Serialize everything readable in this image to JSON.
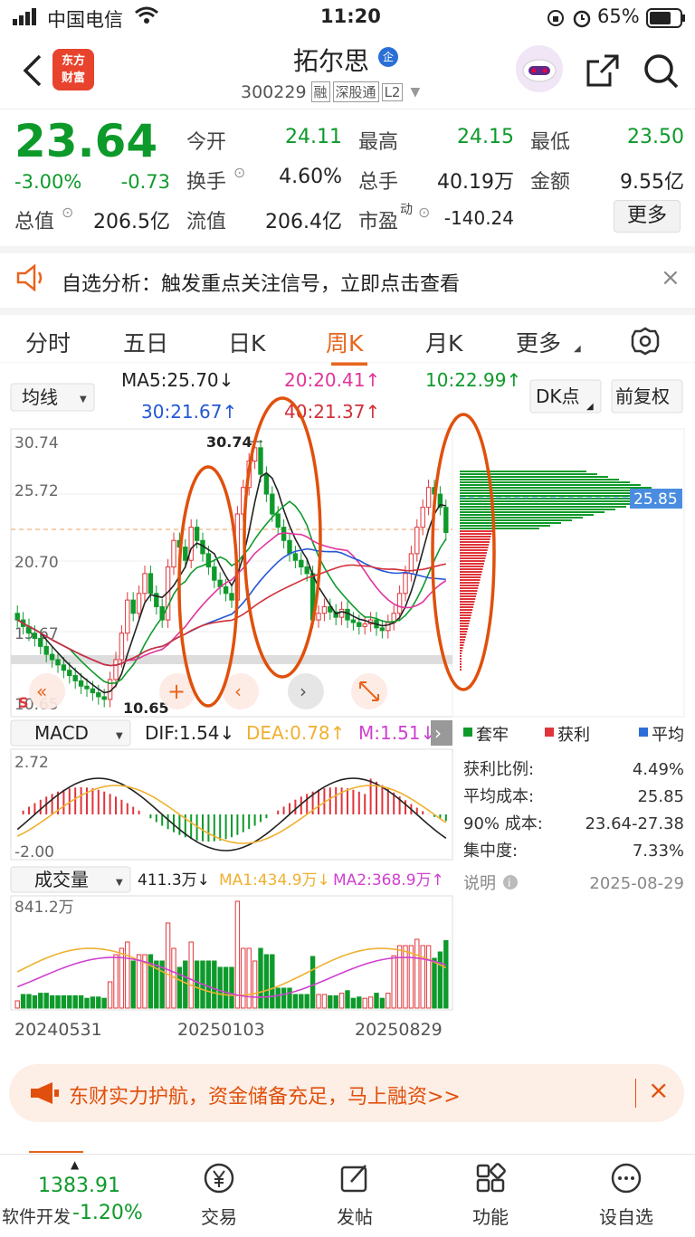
{
  "status_bar": {
    "carrier": "中国电信",
    "time": "11:20",
    "battery": "65%"
  },
  "header": {
    "logo_line1": "东方",
    "logo_line2": "财富",
    "stock_name": "拓尔思",
    "code": "300229",
    "badge_rong": "融",
    "badge_sgt": "深股通",
    "badge_l2": "L2"
  },
  "quote": {
    "price": "23.64",
    "change_pct": "-3.00%",
    "change": "-0.73",
    "open_label": "今开",
    "open": "24.11",
    "high_label": "最高",
    "high": "24.15",
    "low_label": "最低",
    "low": "23.50",
    "turnover_label": "换手",
    "turnover": "4.60%",
    "volume_label": "总手",
    "volume": "40.19万",
    "amount_label": "金额",
    "amount": "9.55亿",
    "mktcap_label": "总值",
    "mktcap": "206.5亿",
    "float_label": "流值",
    "float": "206.4亿",
    "pe_label": "市盈",
    "pe_sup": "动",
    "pe": "-140.24",
    "more_label": "更多"
  },
  "notice": {
    "text": "自选分析：触发重点关注信号，立即点击查看"
  },
  "tabs": [
    "分时",
    "五日",
    "日K",
    "周K",
    "月K",
    "更多"
  ],
  "active_tab": "周K",
  "chart": {
    "ma_select": "均线",
    "ma5": "MA5:25.70↓",
    "ma20": "20:20.41↑",
    "ma10": "10:22.99↑",
    "ma30": "30:21.67↑",
    "ma40": "40:21.37↑",
    "dk_label": "DK点",
    "adjust_label": "前复权",
    "y_labels": [
      "30.74",
      "25.72",
      "20.70",
      "15.67",
      "10.65"
    ],
    "high_mark": "30.74",
    "low_mark": "10.65",
    "chip_price": "25.85",
    "macd_select": "MACD",
    "dif": "DIF:1.54↓",
    "dea": "DEA:0.78↑",
    "m": "M:1.51↓",
    "macd_top": "2.72",
    "macd_bottom": "-2.00",
    "vol_select": "成交量",
    "vol_val": "411.3万↓",
    "vol_ma1": "MA1:434.9万↓",
    "vol_ma2": "MA2:368.9万↑",
    "vol_top": "841.2万",
    "x_labels": [
      "20240531",
      "20250103",
      "20250829"
    ]
  },
  "chips": {
    "legend": [
      "套牢",
      "获利",
      "平均"
    ],
    "rows": [
      {
        "label": "获利比例:",
        "value": "4.49%"
      },
      {
        "label": "平均成本:",
        "value": "25.85"
      },
      {
        "label": "90% 成本:",
        "value": "23.64-27.38"
      },
      {
        "label": "集中度:",
        "value": "7.33%"
      }
    ],
    "note_label": "说明",
    "date": "2025-08-29"
  },
  "banner": {
    "text": "东财实力护航，资金储备充足，马上融资>>"
  },
  "bottom_nav": {
    "index_value": "1383.91",
    "index_name": "软件开发",
    "index_change": "-1.20%",
    "items": [
      "交易",
      "发帖",
      "功能",
      "设自选"
    ]
  },
  "colors": {
    "up": "#e0353b",
    "down": "#0e9a2b",
    "accent": "#e8641c",
    "annotation": "#e0500c"
  }
}
